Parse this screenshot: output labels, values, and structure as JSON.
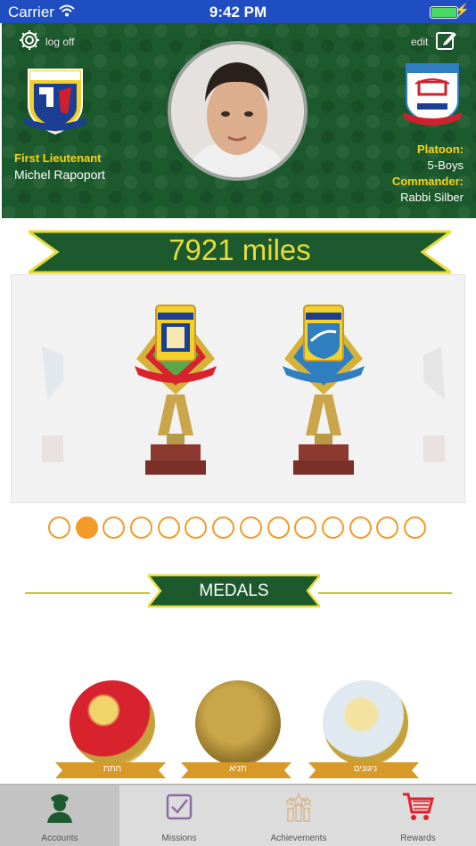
{
  "status_bar": {
    "carrier": "Carrier",
    "time": "9:42 PM"
  },
  "header": {
    "logoff_label": "log off",
    "edit_label": "edit",
    "rank": "First Lieutenant",
    "name": "Michel Rapoport",
    "platoon_label": "Platoon:",
    "platoon_value": "5-Boys",
    "commander_label": "Commander:",
    "commander_value": "Rabbi Silber",
    "left_badge_icon": "tzivos-hashem-logo",
    "right_badge_icon": "base-crest-logo",
    "avatar_icon": "profile-photo"
  },
  "miles": {
    "text": "7921 miles"
  },
  "trophies": [
    {
      "icon": "first-lieutenant-trophy"
    },
    {
      "icon": "captain-trophy"
    }
  ],
  "pager": {
    "count": 14,
    "active_index": 1
  },
  "medals_section": {
    "title": "MEDALS",
    "items": [
      {
        "label": "חתת",
        "color": "red"
      },
      {
        "label": "תניא",
        "color": "gold"
      },
      {
        "label": "ניגונים",
        "color": "silver"
      }
    ]
  },
  "tabs": [
    {
      "label": "Accounts",
      "icon": "soldier-icon",
      "selected": true
    },
    {
      "label": "Missions",
      "icon": "checkbox-icon",
      "selected": false
    },
    {
      "label": "Achievements",
      "icon": "stars-icon",
      "selected": false
    },
    {
      "label": "Rewards",
      "icon": "cart-icon",
      "selected": false
    }
  ],
  "colors": {
    "header_green": "#1c5a2d",
    "accent_yellow": "#f5d418",
    "pager_orange": "#f39b27",
    "status_bar_blue": "#1f4ec3",
    "cart_red": "#e0202a"
  }
}
